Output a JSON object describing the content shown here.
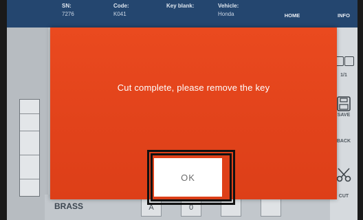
{
  "header": {
    "sn_label": "SN:",
    "sn_value": "7276",
    "code_label": "Code:",
    "code_value": "K041",
    "key_blank_label": "Key blank:",
    "vehicle_label": "Vehicle:",
    "vehicle_value": "Honda",
    "home_label": "HOME",
    "info_label": "INFO"
  },
  "side_panel": {
    "page_indicator": "1/1",
    "save_label": "SAVE",
    "back_label": "BACK",
    "cut_label": "CUT"
  },
  "bottom_bar": {
    "material_label": "BRASS",
    "tool_a_label": "A",
    "tool_b_label": "0"
  },
  "dialog": {
    "message": "Cut complete, please remove the key",
    "ok_label": "OK"
  },
  "colors": {
    "dialog_background": "#e8461d",
    "header_background": "#24466f"
  }
}
